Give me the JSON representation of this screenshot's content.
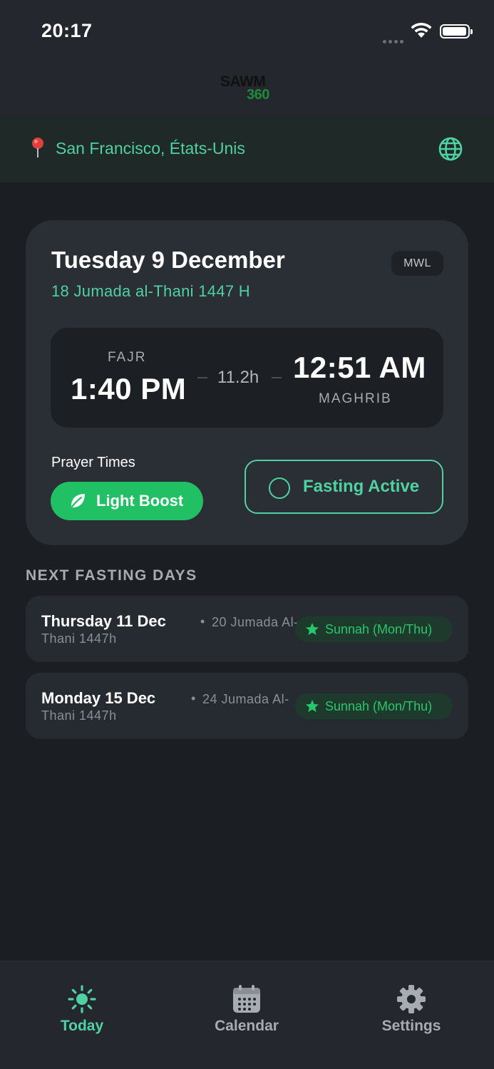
{
  "status_bar": {
    "time": "20:17"
  },
  "app": {
    "logo_top": "SAWM",
    "logo_bottom": "360"
  },
  "location": {
    "text": "San Francisco, États-Unis"
  },
  "today_card": {
    "date": "Tuesday 9 December",
    "hijri": "18 Jumada al-Thani 1447 H",
    "method_badge": "MWL",
    "fajr_label": "FAJR",
    "fajr_time": "1:40 PM",
    "duration": "11.2h",
    "maghrib_time": "12:51 AM",
    "maghrib_label": "MAGHRIB",
    "prayer_times_label": "Prayer Times",
    "light_boost_label": "Light Boost",
    "fasting_button_label": "Fasting Active"
  },
  "next_fasting": {
    "title": "NEXT FASTING DAYS",
    "items": [
      {
        "day": "Thursday 11 Dec",
        "hijri_line1": "20 Jumada Al-",
        "hijri_line2": "Thani 1447h",
        "badge": "Sunnah (Mon/Thu)"
      },
      {
        "day": "Monday 15 Dec",
        "hijri_line1": "24 Jumada Al-",
        "hijri_line2": "Thani 1447h",
        "badge": "Sunnah (Mon/Thu)"
      }
    ]
  },
  "tabs": [
    {
      "label": "Today",
      "icon": "sun-icon",
      "active": true
    },
    {
      "label": "Calendar",
      "icon": "calendar-icon",
      "active": false
    },
    {
      "label": "Settings",
      "icon": "gear-icon",
      "active": false
    }
  ],
  "colors": {
    "accent": "#4fd1a1",
    "green": "#22c064",
    "background": "#1b1e23",
    "inactive_tab": "#a7abb2"
  }
}
